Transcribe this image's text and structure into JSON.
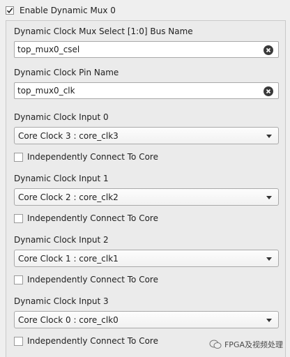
{
  "enable": {
    "label": "Enable Dynamic Mux 0",
    "checked": true
  },
  "bus_name": {
    "label": "Dynamic Clock Mux Select [1:0] Bus Name",
    "value": "top_mux0_csel"
  },
  "pin_name": {
    "label": "Dynamic Clock Pin Name",
    "value": "top_mux0_clk"
  },
  "inputs": [
    {
      "label": "Dynamic Clock Input 0",
      "selected": "Core Clock 3 : core_clk3",
      "connect_label": "Independently Connect To Core",
      "connect_checked": false
    },
    {
      "label": "Dynamic Clock Input 1",
      "selected": "Core Clock 2 : core_clk2",
      "connect_label": "Independently Connect To Core",
      "connect_checked": false
    },
    {
      "label": "Dynamic Clock Input 2",
      "selected": "Core Clock 1 : core_clk1",
      "connect_label": "Independently Connect To Core",
      "connect_checked": false
    },
    {
      "label": "Dynamic Clock Input 3",
      "selected": "Core Clock 0 : core_clk0",
      "connect_label": "Independently Connect To Core",
      "connect_checked": false
    }
  ],
  "watermark": "FPGA及视频处理",
  "colors": {
    "background": "#efefef",
    "field_border": "#a9a9a9",
    "clear_button": "#3a3a3a"
  }
}
